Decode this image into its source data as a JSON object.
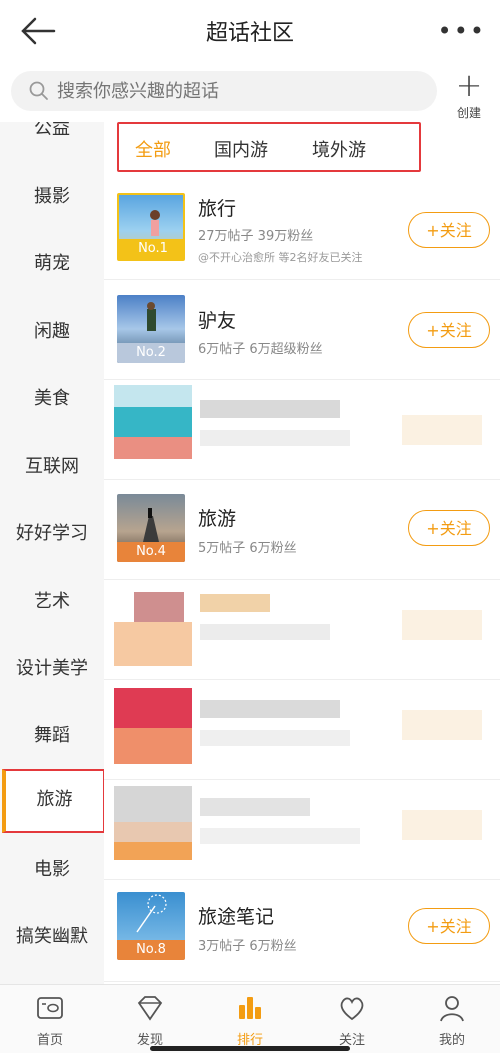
{
  "header": {
    "title": "超话社区",
    "more_label": "•••"
  },
  "search": {
    "placeholder": "搜索你感兴趣的超话",
    "create_label": "创建"
  },
  "sidebar": {
    "items": [
      {
        "label": "公益"
      },
      {
        "label": "摄影"
      },
      {
        "label": "萌宠"
      },
      {
        "label": "闲趣"
      },
      {
        "label": "美食"
      },
      {
        "label": "互联网"
      },
      {
        "label": "好好学习"
      },
      {
        "label": "艺术"
      },
      {
        "label": "设计美学"
      },
      {
        "label": "舞蹈"
      },
      {
        "label": "旅游"
      },
      {
        "label": "电影"
      },
      {
        "label": "搞笑幽默"
      }
    ],
    "selected": "旅游"
  },
  "filter": {
    "tabs": [
      "全部",
      "国内游",
      "境外游"
    ],
    "active": "全部"
  },
  "list": [
    {
      "name": "旅行",
      "rank": "No.1",
      "meta": "27万帖子 39万粉丝",
      "sub": "@不开心治愈所 等2名好友已关注",
      "follow": "+关注"
    },
    {
      "name": "驴友",
      "rank": "No.2",
      "meta": "6万帖子 6万超级粉丝",
      "follow": "+关注"
    },
    {
      "name": "旅游",
      "rank": "No.4",
      "meta": "5万帖子 6万粉丝",
      "follow": "+关注"
    },
    {
      "name": "旅途笔记",
      "rank": "No.8",
      "meta": "3万帖子 6万粉丝",
      "follow": "+关注"
    }
  ],
  "tabbar": {
    "items": [
      {
        "label": "首页"
      },
      {
        "label": "发现"
      },
      {
        "label": "排行"
      },
      {
        "label": "关注"
      },
      {
        "label": "我的"
      }
    ],
    "active": "排行"
  },
  "colors": {
    "accent": "#f39c12",
    "highlight": "#e4393c"
  }
}
